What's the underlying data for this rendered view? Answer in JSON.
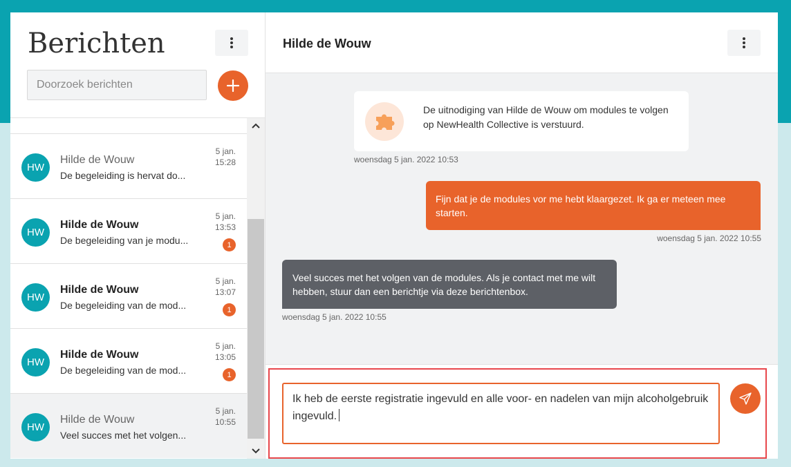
{
  "left_panel": {
    "title": "Berichten",
    "search_placeholder": "Doorzoek berichten",
    "conversations": [
      {
        "initials": "HW",
        "name": "Hilde de Wouw",
        "preview": "De begeleiding is hervat do...",
        "date": "5 jan.",
        "time": "15:28",
        "unread": false,
        "unread_count": ""
      },
      {
        "initials": "HW",
        "name": "Hilde de Wouw",
        "preview": "De begeleiding van je modu...",
        "date": "5 jan.",
        "time": "13:53",
        "unread": true,
        "unread_count": "1"
      },
      {
        "initials": "HW",
        "name": "Hilde de Wouw",
        "preview": "De begeleiding van de mod...",
        "date": "5 jan.",
        "time": "13:07",
        "unread": true,
        "unread_count": "1"
      },
      {
        "initials": "HW",
        "name": "Hilde de Wouw",
        "preview": "De begeleiding van de mod...",
        "date": "5 jan.",
        "time": "13:05",
        "unread": true,
        "unread_count": "1"
      },
      {
        "initials": "HW",
        "name": "Hilde de Wouw",
        "preview": "Veel succes met het volgen...",
        "date": "5 jan.",
        "time": "10:55",
        "unread": false,
        "unread_count": ""
      }
    ]
  },
  "conversation": {
    "contact_name": "Hilde de Wouw",
    "system_message": {
      "text": "De uitnodiging van Hilde de Wouw om modules te volgen op NewHealth Collective is verstuurd.",
      "timestamp": "woensdag 5 jan. 2022 10:53",
      "icon": "puzzle-icon"
    },
    "outgoing_message": {
      "text": "Fijn dat je de modules vor me hebt klaargezet. Ik ga er meteen mee starten.",
      "timestamp": "woensdag 5 jan. 2022 10:55"
    },
    "incoming_message": {
      "text": "Veel succes met het volgen van de modules. Als je contact met me wilt hebben, stuur dan een berichtje via deze berichtenbox.",
      "timestamp": "woensdag 5 jan. 2022 10:55"
    },
    "compose_value": "Ik heb de eerste registratie ingevuld en alle voor- en nadelen van mijn alcoholgebruik ingevuld."
  },
  "colors": {
    "accent": "#e8632b",
    "teal": "#0aa3b0",
    "incoming_bubble": "#5d6066",
    "highlight_frame": "#e8464b"
  }
}
